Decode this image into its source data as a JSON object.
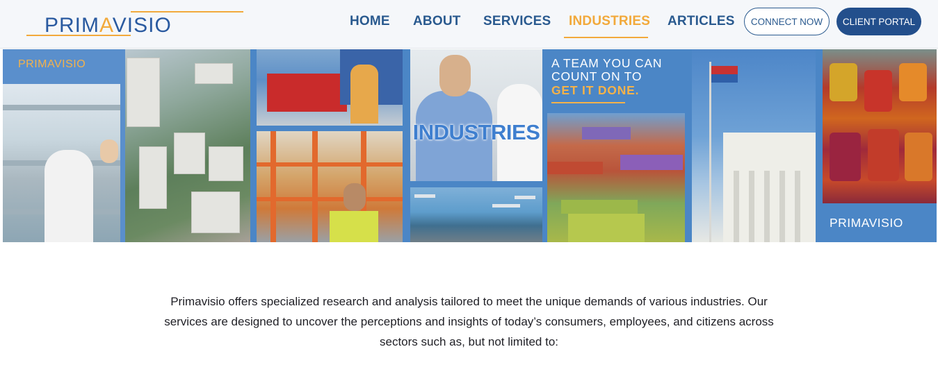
{
  "header": {
    "logo": {
      "text_prefix": "PRIM",
      "text_accent": "A",
      "text_suffix": "VISIO"
    },
    "nav": [
      {
        "label": "HOME",
        "active": false
      },
      {
        "label": "ABOUT",
        "active": false
      },
      {
        "label": "SERVICES",
        "active": false
      },
      {
        "label": "INDUSTRIES",
        "active": true
      },
      {
        "label": "ARTICLES",
        "active": false
      }
    ],
    "connect_label": "CONNECT NOW",
    "portal_label": "CLIENT PORTAL"
  },
  "hero": {
    "left_label": "PRIMAVISIO",
    "title": "INDUSTRIES",
    "tagline_line1": "A TEAM YOU CAN",
    "tagline_line2": "COUNT ON TO",
    "tagline_line3": "GET IT DONE.",
    "right_label": "PRIMAVISIO"
  },
  "intro": {
    "text": "Primavisio offers specialized research and analysis tailored to meet the unique demands of various industries. Our services are designed to uncover the perceptions and insights of today’s consumers, employees, and citizens across sectors such as, but not limited to:"
  },
  "colors": {
    "brand_blue": "#2a5a8f",
    "accent_orange": "#f2a93b",
    "hero_blue": "#4b86c6",
    "portal_button": "#234f8c"
  }
}
